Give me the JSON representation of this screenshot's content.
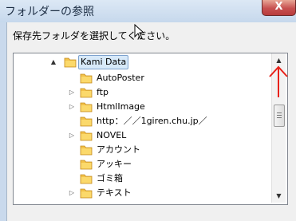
{
  "window": {
    "title": "フォルダーの参照",
    "close_label": "X"
  },
  "dialog": {
    "instruction": "保存先フォルダを選択してください。"
  },
  "tree": {
    "root": {
      "label": "Kami Data",
      "expanded": true,
      "selected": true
    },
    "items": [
      {
        "label": "AutoPoster",
        "has_children": false
      },
      {
        "label": "ftp",
        "has_children": true
      },
      {
        "label": "HtmlImage",
        "has_children": true
      },
      {
        "label": "http：／／1giren.chu.jp／",
        "has_children": false
      },
      {
        "label": "NOVEL",
        "has_children": true
      },
      {
        "label": "アカウント",
        "has_children": false
      },
      {
        "label": "アッキー",
        "has_children": false
      },
      {
        "label": "ゴミ箱",
        "has_children": false
      },
      {
        "label": "テキスト",
        "has_children": true
      }
    ]
  },
  "colors": {
    "annotation_arrow": "#e8221a",
    "folder": "#f2c24a"
  },
  "icons": {
    "expander_open": "▲",
    "expander_closed": "▷",
    "scroll_up": "▲",
    "scroll_down": "▼"
  }
}
